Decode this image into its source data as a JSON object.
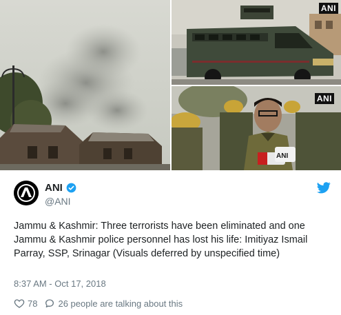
{
  "media": {
    "watermark_top_right": "ANI",
    "watermark_bottom_right": "ANI",
    "mic_text": "ANI"
  },
  "tweet": {
    "author_name": "ANI",
    "author_handle": "@ANI",
    "verified_icon": "verified-badge-icon",
    "platform_icon": "twitter-bird-icon",
    "text": "Jammu & Kashmir: Three terrorists have been eliminated and one Jammu & Kashmir police personnel has lost his life: Imitiyaz Ismail Parray, SSP, Srinagar (Visuals deferred by unspecified time)",
    "timestamp": "8:37 AM - Oct 17, 2018",
    "likes": "78",
    "talking": "26 people are talking about this"
  },
  "colors": {
    "accent": "#1da1f2",
    "text": "#1c2022",
    "muted": "#697882"
  }
}
